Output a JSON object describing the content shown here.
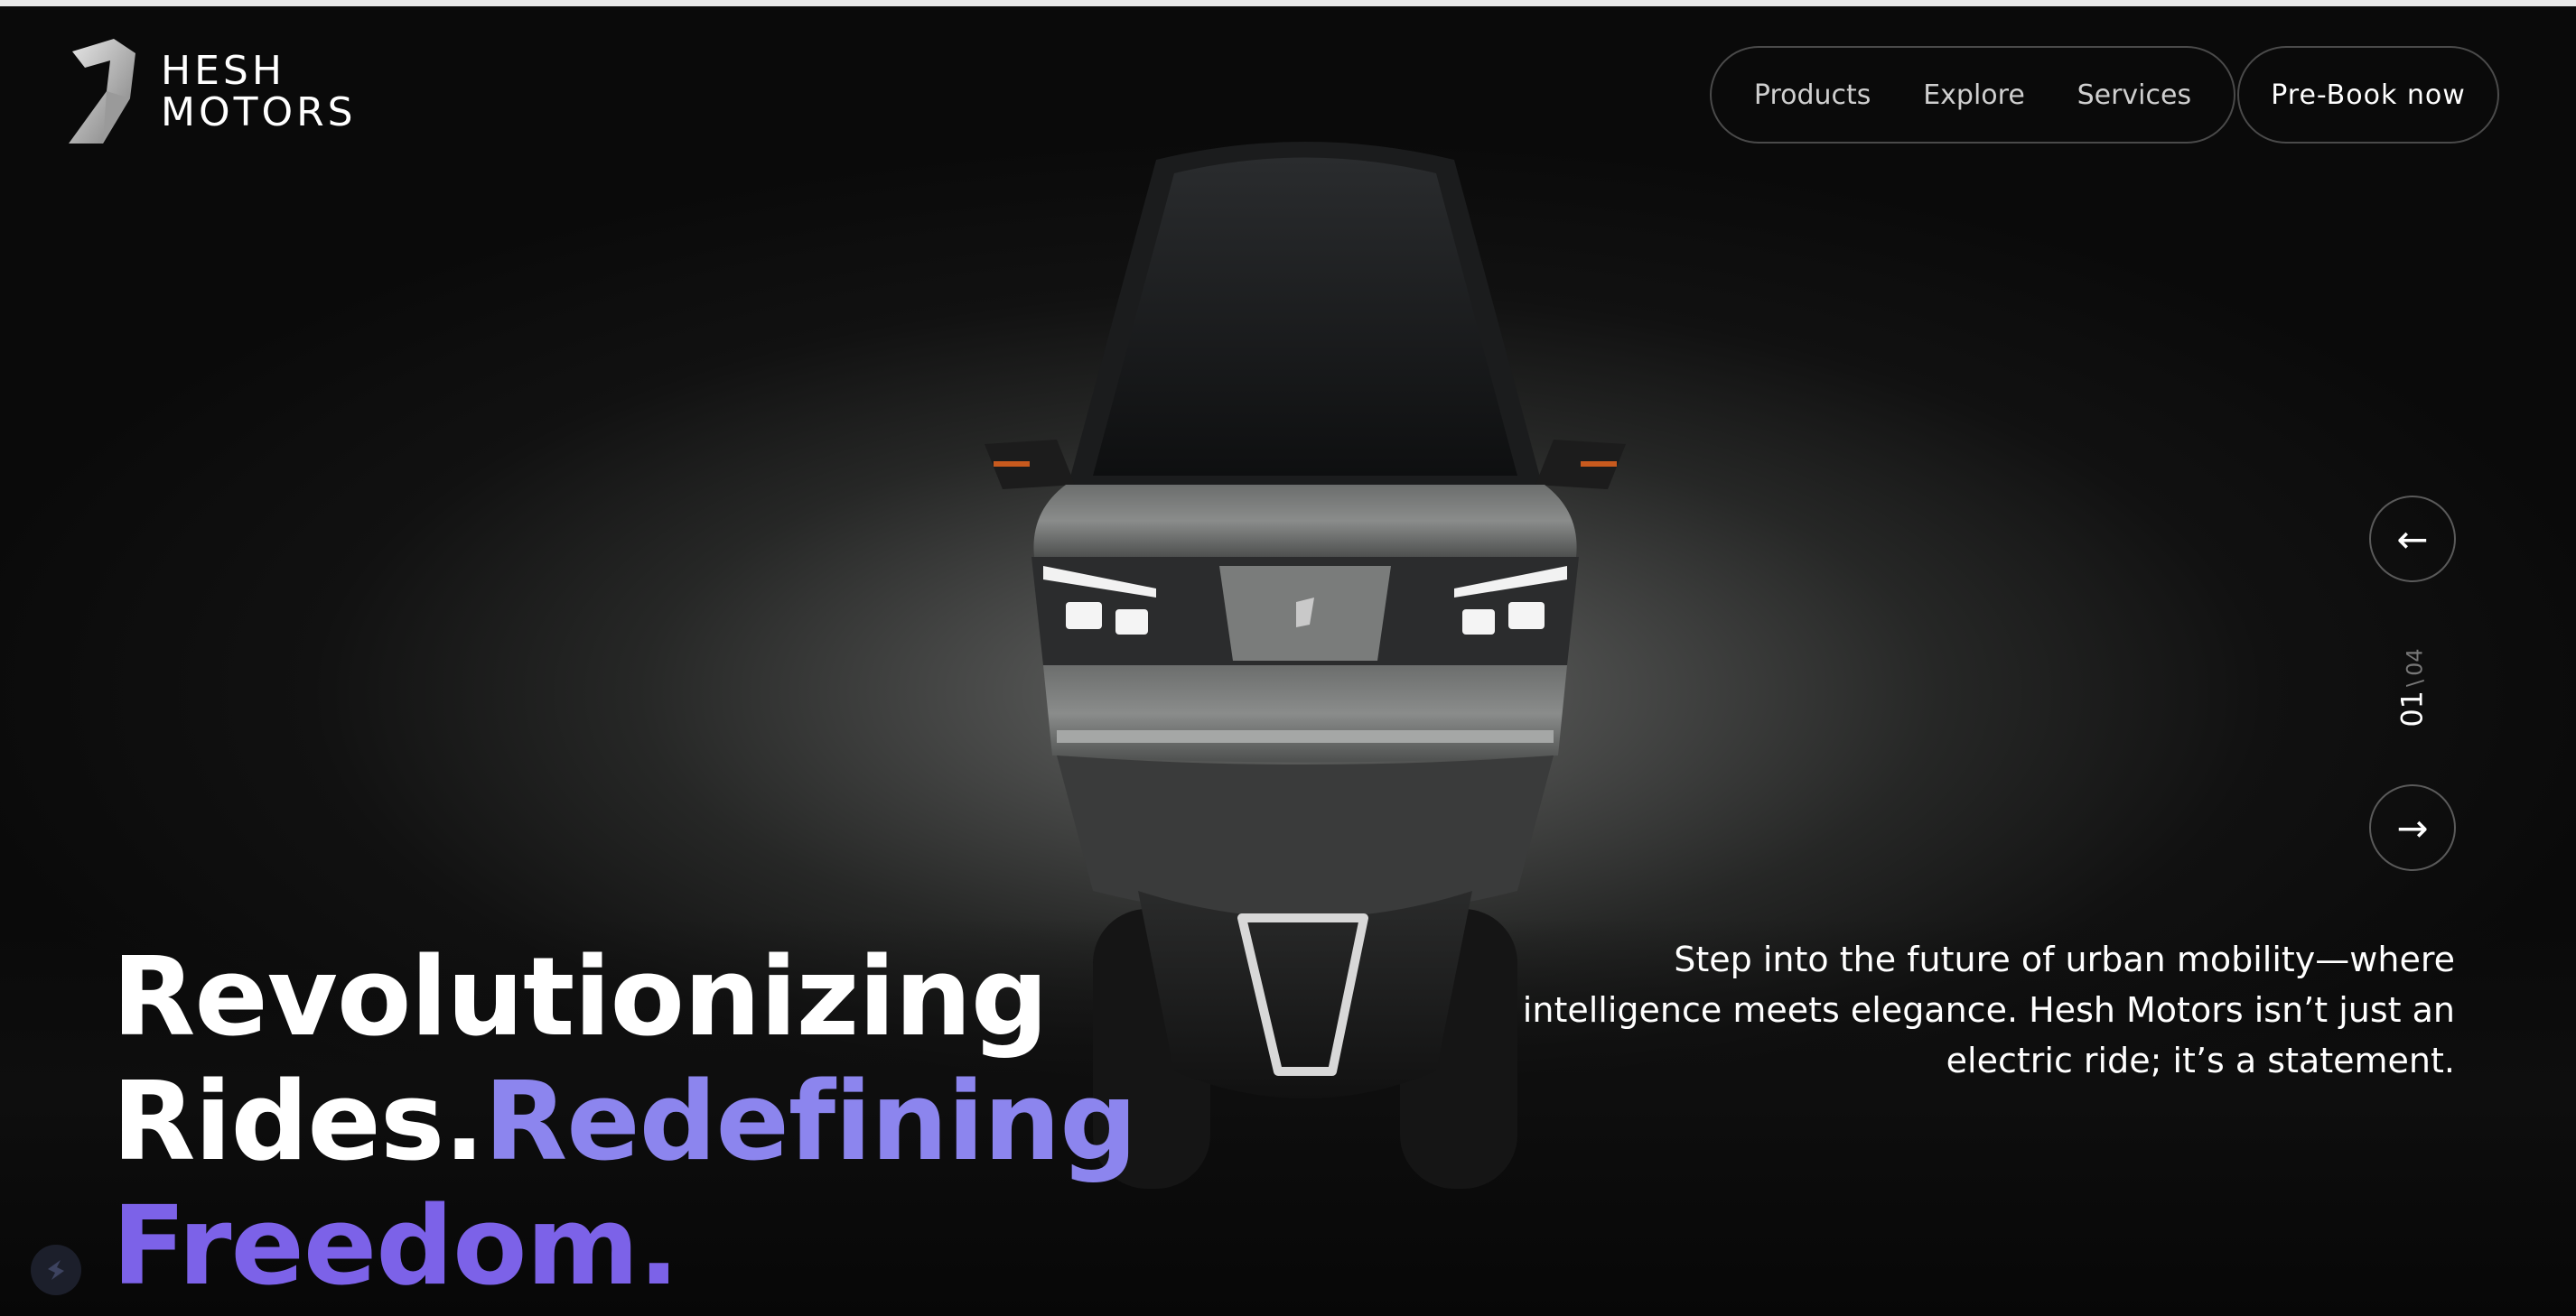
{
  "brand": {
    "name_line1": "HESH",
    "name_line2": "MOTORS",
    "logo_icon": "hesh-logo-icon"
  },
  "nav": {
    "items": [
      {
        "label": "Products"
      },
      {
        "label": "Explore"
      },
      {
        "label": "Services"
      }
    ],
    "cta_label": "Pre-Book now"
  },
  "hero": {
    "headline_white_1": "Revolutionizing",
    "headline_white_2": "Rides.",
    "headline_accent_1": "Redefining",
    "headline_accent_2": "Freedom.",
    "description": "Step into the future of urban mobility—where intelligence meets elegance. Hesh Motors isn’t just an electric ride; it’s a statement."
  },
  "slider": {
    "prev_icon": "←",
    "next_icon": "→",
    "current": "01",
    "separator": "\\",
    "total": "04"
  },
  "colors": {
    "accent_light": "#8c85ee",
    "accent_deep": "#7c62e8",
    "background": "#0b0b0b",
    "headlight_green": "#5fd36a"
  }
}
